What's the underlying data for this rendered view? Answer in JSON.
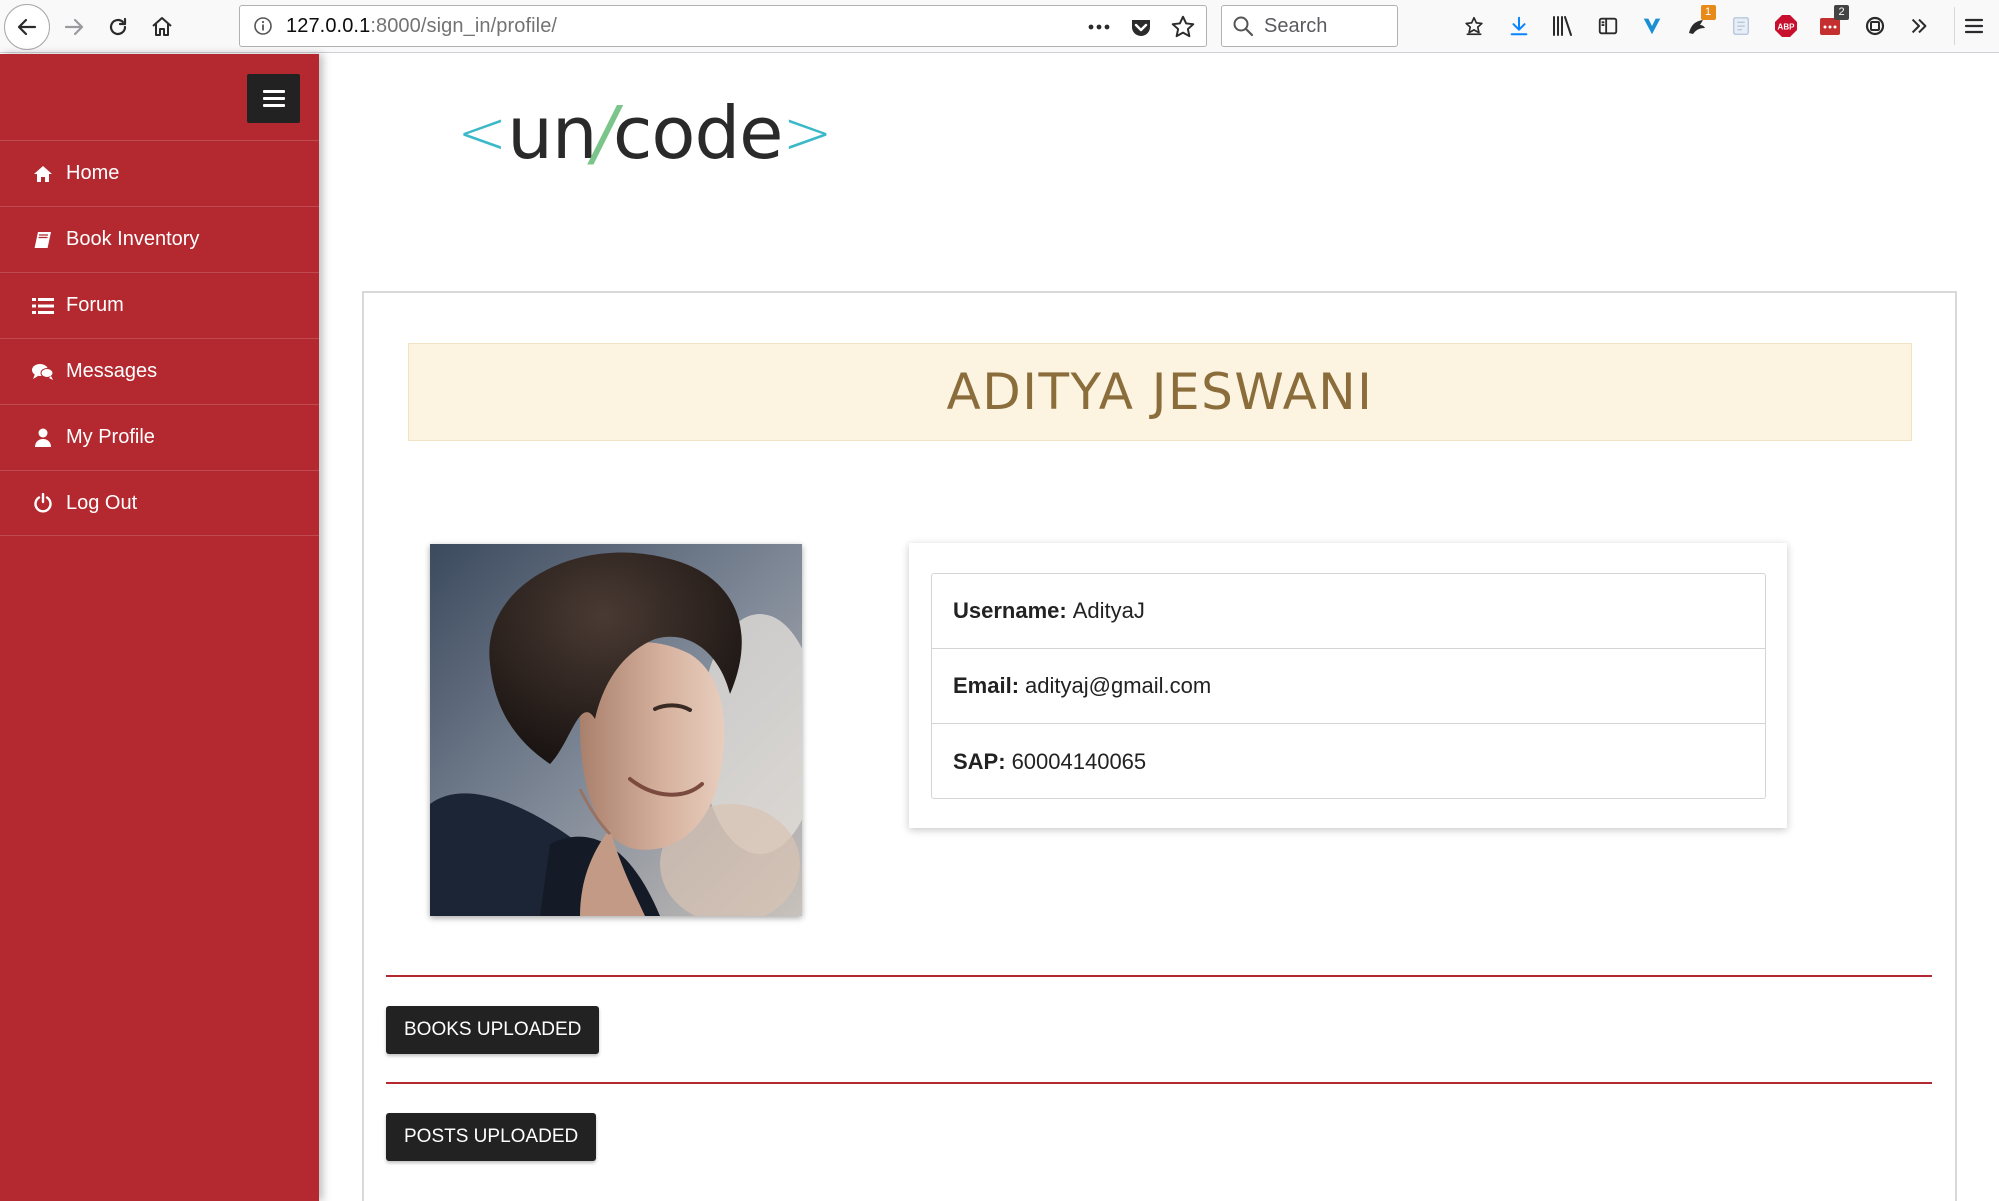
{
  "browser": {
    "url_host": "127.0.0.1",
    "url_path": ":8000/sign_in/profile/",
    "search_placeholder": "Search",
    "toolbar_icons": [
      {
        "name": "bookmarks-star-icon",
        "badge": ""
      },
      {
        "name": "download-icon",
        "badge": ""
      },
      {
        "name": "library-icon",
        "badge": ""
      },
      {
        "name": "sidebar-icon",
        "badge": ""
      },
      {
        "name": "extension-v-icon",
        "badge": ""
      },
      {
        "name": "extension-notify-icon",
        "badge": "1"
      },
      {
        "name": "extension-page-icon",
        "badge": ""
      },
      {
        "name": "adblock-icon",
        "badge": ""
      },
      {
        "name": "extension-calendar-icon",
        "badge": "2"
      },
      {
        "name": "extension-sync-icon",
        "badge": ""
      },
      {
        "name": "overflow-chevron-icon",
        "badge": ""
      }
    ]
  },
  "sidebar": {
    "items": [
      {
        "label": "Home",
        "icon": "home-icon"
      },
      {
        "label": "Book Inventory",
        "icon": "book-icon"
      },
      {
        "label": "Forum",
        "icon": "list-icon"
      },
      {
        "label": "Messages",
        "icon": "chat-icon"
      },
      {
        "label": "My Profile",
        "icon": "user-icon"
      },
      {
        "label": "Log Out",
        "icon": "power-icon"
      }
    ]
  },
  "logo": {
    "open": "<",
    "left": "un",
    "slash": "/",
    "right": "code",
    "close": ">"
  },
  "profile": {
    "name": "ADITYA JESWANI",
    "fields": [
      {
        "key": "Username:",
        "value": "AdityaJ"
      },
      {
        "key": "Email:",
        "value": "adityaj@gmail.com"
      },
      {
        "key": "SAP:",
        "value": "60004140065"
      }
    ]
  },
  "buttons": {
    "books_uploaded": "BOOKS UPLOADED",
    "posts_uploaded": "POSTS UPLOADED"
  },
  "colors": {
    "sidebar": "#b3292f",
    "banner_bg": "#fcf4e0",
    "banner_text": "#8a6d3b",
    "logo_bracket": "#3bb9c9",
    "logo_slash": "#7bc58a"
  }
}
